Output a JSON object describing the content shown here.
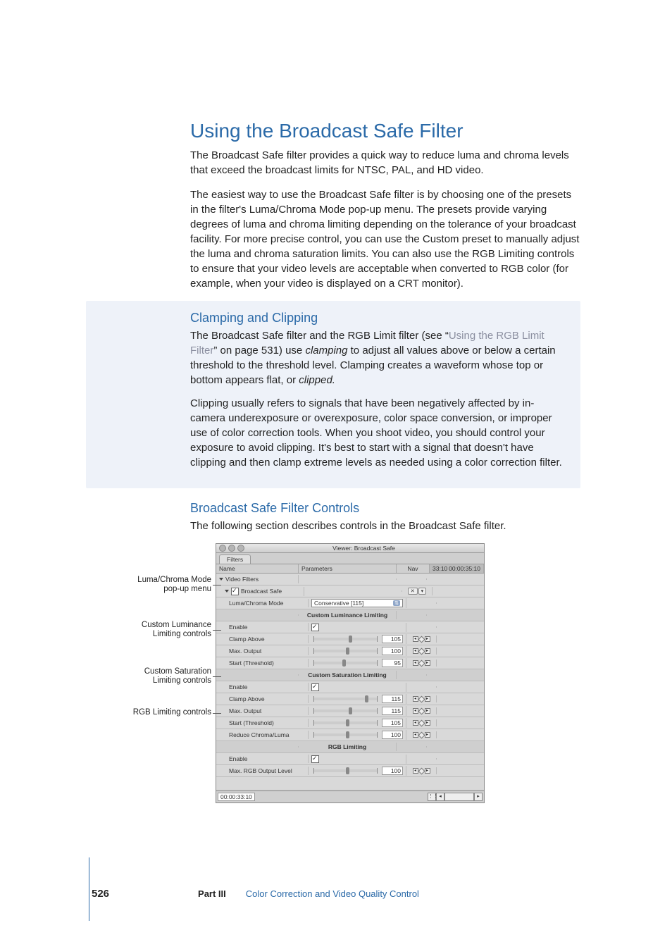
{
  "page": {
    "number": "526",
    "part_label": "Part III",
    "part_title": "Color Correction and Video Quality Control"
  },
  "h1": "Using the Broadcast Safe Filter",
  "p1": "The Broadcast Safe filter provides a quick way to reduce luma and chroma levels that exceed the broadcast limits for NTSC, PAL, and HD video.",
  "p2": "The easiest way to use the Broadcast Safe filter is by choosing one of the presets in the filter's Luma/Chroma Mode pop-up menu. The presets provide varying degrees of luma and chroma limiting depending on the tolerance of your broadcast facility. For more precise control, you can use the Custom preset to manually adjust the luma and chroma saturation limits. You can also use the RGB Limiting controls to ensure that your video levels are acceptable when converted to RGB color (for example, when your video is displayed on a CRT monitor).",
  "callout": {
    "h": "Clamping and Clipping",
    "p1a": "The Broadcast Safe filter and the RGB Limit filter (see “",
    "p1_link": "Using the RGB Limit Filter",
    "p1b": "” on page 531) use ",
    "p1_em1": "clamping",
    "p1c": " to adjust all values above or below a certain threshold to the threshold level. Clamping creates a waveform whose top or bottom appears flat, or ",
    "p1_em2": "clipped.",
    "p2": "Clipping usually refers to signals that have been negatively affected by in-camera underexposure or overexposure, color space conversion, or improper use of color correction tools. When you shoot video, you should control your exposure to avoid clipping. It's best to start with a signal that doesn't have clipping and then clamp extreme levels as needed using a color correction filter."
  },
  "h2": "Broadcast Safe Filter Controls",
  "p3": "The following section describes controls in the Broadcast Safe filter.",
  "figure_labels": {
    "l1": "Luma/Chroma Mode pop-up menu",
    "l2": "Custom Luminance Limiting controls",
    "l3": "Custom Saturation Limiting controls",
    "l4": "RGB Limiting controls"
  },
  "viewer": {
    "title": "Viewer: Broadcast Safe",
    "tab": "Filters",
    "hdr_name": "Name",
    "hdr_param": "Parameters",
    "hdr_nav": "Nav",
    "tl_in": "33:10",
    "tl_out": "00:00:35:10",
    "group": "Video Filters",
    "filter": "Broadcast Safe",
    "mode_label": "Luma/Chroma Mode",
    "mode_value": "Conservative [115]",
    "sec_lum": "Custom Luminance Limiting",
    "sec_sat": "Custom Saturation Limiting",
    "sec_rgb": "RGB Limiting",
    "r_enable": "Enable",
    "r_clamp": "Clamp Above",
    "r_maxout": "Max. Output",
    "r_start": "Start (Threshold)",
    "r_reduce": "Reduce Chroma/Luma",
    "r_maxrgb": "Max. RGB Output Level",
    "vals": {
      "lum_clamp": "105",
      "lum_max": "100",
      "lum_start": "95",
      "sat_clamp": "115",
      "sat_max": "115",
      "sat_start": "105",
      "sat_reduce": "100",
      "rgb_max": "100"
    },
    "tc": "00:00:33:10"
  }
}
